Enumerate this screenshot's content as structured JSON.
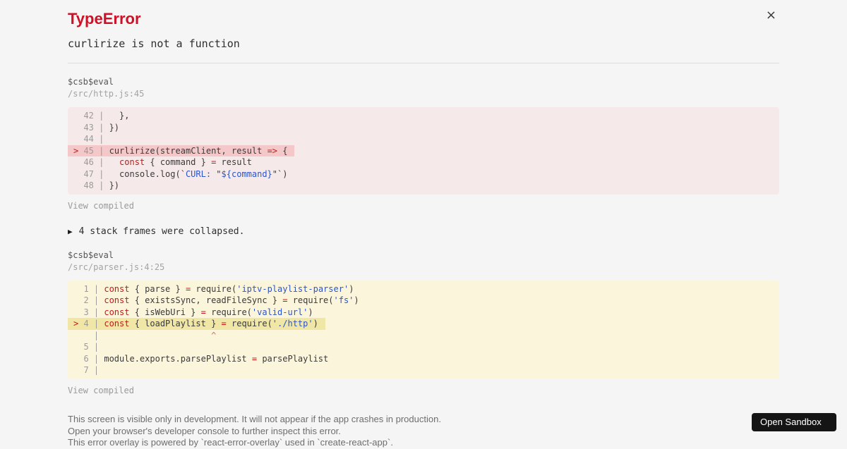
{
  "theme": {
    "background": "#f5f5f5",
    "title_red": "#ce1126",
    "keyword_red": "#c41a16",
    "string_blue": "#2c55c8",
    "code_pink_bg": "#f6e9e9",
    "code_pink_highlight": "#f4c8c8",
    "code_yellow_bg": "#fbf5dc",
    "code_yellow_highlight": "#f0e6a6",
    "button_bg": "#151515"
  },
  "header": {
    "title": "TypeError",
    "message": "curlirize is not a function",
    "close_icon": "×"
  },
  "frames": [
    {
      "function": "$csb$eval",
      "location": "/src/http.js:45",
      "variant": "pink",
      "view_compiled_label": "View compiled",
      "lines": [
        {
          "gutter": "  42 | ",
          "tokens": [
            [
              "p",
              "  },"
            ]
          ]
        },
        {
          "gutter": "  43 | ",
          "tokens": [
            [
              "p",
              "})"
            ]
          ]
        },
        {
          "gutter": "  44 | ",
          "tokens": []
        },
        {
          "gutter": "> 45 | ",
          "highlight": true,
          "tokens": [
            [
              "p",
              "curlirize(streamClient, result "
            ],
            [
              "o",
              "=>"
            ],
            [
              "p",
              " {"
            ]
          ]
        },
        {
          "gutter": "  46 | ",
          "tokens": [
            [
              "p",
              "  "
            ],
            [
              "k",
              "const"
            ],
            [
              "p",
              " { command } "
            ],
            [
              "o",
              "="
            ],
            [
              "p",
              " result"
            ]
          ]
        },
        {
          "gutter": "  47 | ",
          "tokens": [
            [
              "p",
              "  console.log(`"
            ],
            [
              "s",
              "CURL:"
            ],
            [
              "p",
              " \""
            ],
            [
              "s",
              "${command}"
            ],
            [
              "p",
              "\"`)"
            ]
          ]
        },
        {
          "gutter": "  48 | ",
          "tokens": [
            [
              "p",
              "})"
            ]
          ]
        }
      ]
    },
    {
      "function": "$csb$eval",
      "location": "/src/parser.js:4:25",
      "variant": "yellow",
      "view_compiled_label": "View compiled",
      "lines": [
        {
          "gutter": "  1 | ",
          "tokens": [
            [
              "k",
              "const"
            ],
            [
              "p",
              " { parse } "
            ],
            [
              "o",
              "="
            ],
            [
              "p",
              " require("
            ],
            [
              "s",
              "'iptv-playlist-parser'"
            ],
            [
              "p",
              ")"
            ]
          ]
        },
        {
          "gutter": "  2 | ",
          "tokens": [
            [
              "k",
              "const"
            ],
            [
              "p",
              " { existsSync, readFileSync } "
            ],
            [
              "o",
              "="
            ],
            [
              "p",
              " require("
            ],
            [
              "s",
              "'fs'"
            ],
            [
              "p",
              ")"
            ]
          ]
        },
        {
          "gutter": "  3 | ",
          "tokens": [
            [
              "k",
              "const"
            ],
            [
              "p",
              " { isWebUri } "
            ],
            [
              "o",
              "="
            ],
            [
              "p",
              " require("
            ],
            [
              "s",
              "'valid-url'"
            ],
            [
              "p",
              ")"
            ]
          ]
        },
        {
          "gutter": "> 4 | ",
          "highlight": true,
          "tokens": [
            [
              "k",
              "const"
            ],
            [
              "p",
              " { loadPlaylist } "
            ],
            [
              "o",
              "="
            ],
            [
              "p",
              " require("
            ],
            [
              "s",
              "'./http'"
            ],
            [
              "p",
              ")"
            ]
          ]
        },
        {
          "gutter": "    | ",
          "tokens": [
            [
              "c",
              "                     ^"
            ]
          ]
        },
        {
          "gutter": "  5 | ",
          "tokens": []
        },
        {
          "gutter": "  6 | ",
          "tokens": [
            [
              "p",
              "module.exports.parsePlaylist "
            ],
            [
              "o",
              "="
            ],
            [
              "p",
              " parsePlaylist"
            ]
          ]
        },
        {
          "gutter": "  7 | ",
          "tokens": []
        }
      ]
    }
  ],
  "collapsed": {
    "icon": "▶",
    "label": "4 stack frames were collapsed."
  },
  "footer": {
    "lines": [
      "This screen is visible only in development. It will not appear if the app crashes in production.",
      "Open your browser's developer console to further inspect this error.",
      "This error overlay is powered by `react-error-overlay` used in `create-react-app`."
    ]
  },
  "sandbox_button": {
    "label": "Open Sandbox"
  }
}
